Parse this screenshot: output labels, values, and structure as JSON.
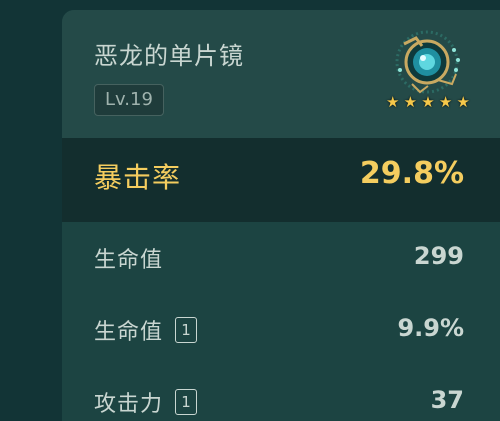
{
  "artifact": {
    "name": "恶龙的单片镜",
    "level": "Lv.19",
    "rarity_stars": 5,
    "star_glyph": "★",
    "icon": "monocle-icon"
  },
  "main_stat": {
    "label": "暴击率",
    "value": "29.8%"
  },
  "sub_stats": [
    {
      "label": "生命值",
      "badge": "",
      "value": "299"
    },
    {
      "label": "生命值",
      "badge": "1",
      "value": "9.9%"
    },
    {
      "label": "攻击力",
      "badge": "1",
      "value": "37"
    }
  ],
  "colors": {
    "background": "#123436",
    "panel": "#1c4442",
    "header": "#244a48",
    "main_row": "#132e2e",
    "gold": "#f4cd5f",
    "text": "#c9d6d1"
  }
}
